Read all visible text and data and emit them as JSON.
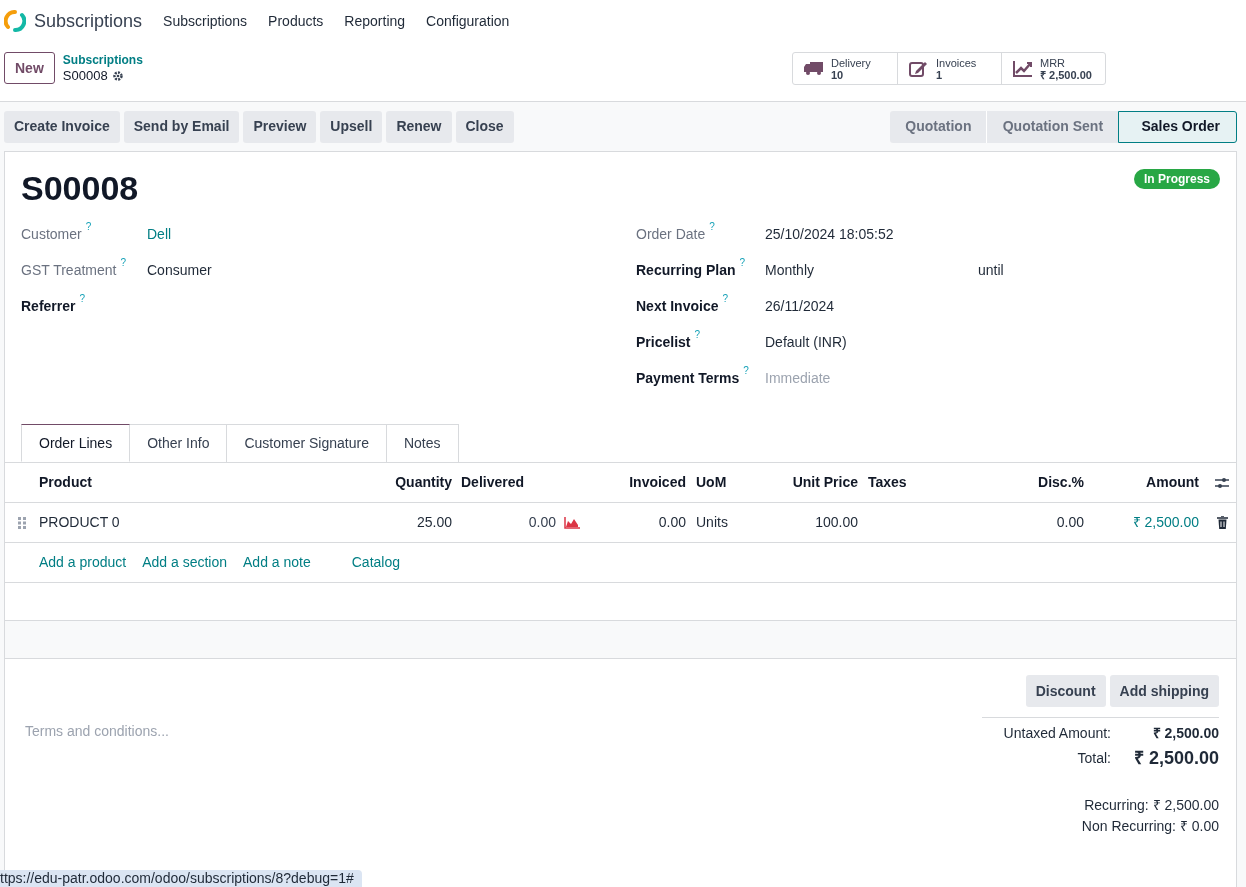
{
  "navbar": {
    "app_name": "Subscriptions",
    "menu": [
      "Subscriptions",
      "Products",
      "Reporting",
      "Configuration"
    ]
  },
  "control_panel": {
    "new_button": "New",
    "breadcrumb": {
      "parent": "Subscriptions",
      "current": "S00008"
    },
    "smart_buttons": [
      {
        "kind": "delivery",
        "label": "Delivery",
        "value": "10"
      },
      {
        "kind": "invoices",
        "label": "Invoices",
        "value": "1"
      },
      {
        "kind": "mrr",
        "label": "MRR",
        "value": "₹ 2,500.00"
      }
    ]
  },
  "action_buttons": [
    "Create Invoice",
    "Send by Email",
    "Preview",
    "Upsell",
    "Renew",
    "Close"
  ],
  "status_steps": [
    {
      "label": "Quotation",
      "selected": false
    },
    {
      "label": "Quotation Sent",
      "selected": false
    },
    {
      "label": "Sales Order",
      "selected": true
    }
  ],
  "form": {
    "title": "S00008",
    "status_badge": "In Progress",
    "left_fields": [
      {
        "label": "Customer",
        "help": "?",
        "required": false,
        "kind": "link",
        "value": "Dell"
      },
      {
        "label": "GST Treatment",
        "help": "?",
        "required": false,
        "kind": "text",
        "value": "Consumer"
      },
      {
        "label": "Referrer",
        "help": "?",
        "required": true,
        "kind": "empty"
      }
    ],
    "right_fields": [
      {
        "label": "Order Date",
        "help": "?",
        "required": false,
        "kind": "text",
        "value": "25/10/2024 18:05:52"
      },
      {
        "label": "Recurring Plan",
        "help": "?",
        "required": true,
        "kind": "text",
        "value": "Monthly",
        "suffix": "until"
      },
      {
        "label": "Next Invoice",
        "help": "?",
        "required": true,
        "kind": "text",
        "value": "26/11/2024"
      },
      {
        "label": "Pricelist",
        "help": "?",
        "required": true,
        "kind": "text",
        "value": "Default (INR)"
      },
      {
        "label": "Payment Terms",
        "help": "?",
        "required": true,
        "kind": "placeholder",
        "placeholder": "Immediate"
      }
    ]
  },
  "tabs": [
    {
      "label": "Order Lines",
      "selected": true
    },
    {
      "label": "Other Info",
      "selected": false
    },
    {
      "label": "Customer Signature",
      "selected": false
    },
    {
      "label": "Notes",
      "selected": false
    }
  ],
  "order_lines": {
    "columns": [
      "Product",
      "Quantity",
      "Delivered",
      "Invoiced",
      "UoM",
      "Unit Price",
      "Taxes",
      "Disc.%",
      "Amount"
    ],
    "rows": [
      {
        "product": "PRODUCT 0",
        "quantity": "25.00",
        "delivered": "0.00",
        "invoiced": "0.00",
        "uom": "Units",
        "unit_price": "100.00",
        "disc": "0.00",
        "amount": "₹ 2,500.00"
      }
    ],
    "add_links": [
      "Add a product",
      "Add a section",
      "Add a note",
      "Catalog"
    ]
  },
  "footer": {
    "terms_placeholder": "Terms and conditions...",
    "buttons": [
      "Discount",
      "Add shipping"
    ],
    "untaxed_label": "Untaxed Amount:",
    "untaxed_value": "₹ 2,500.00",
    "total_label": "Total:",
    "total_value": "₹ 2,500.00",
    "recurring": "Recurring: ₹ 2,500.00",
    "non_recurring": "Non Recurring: ₹ 0.00"
  },
  "link_preview": "ttps://edu-patr.odoo.com/odoo/subscriptions/8?debug=1#"
}
